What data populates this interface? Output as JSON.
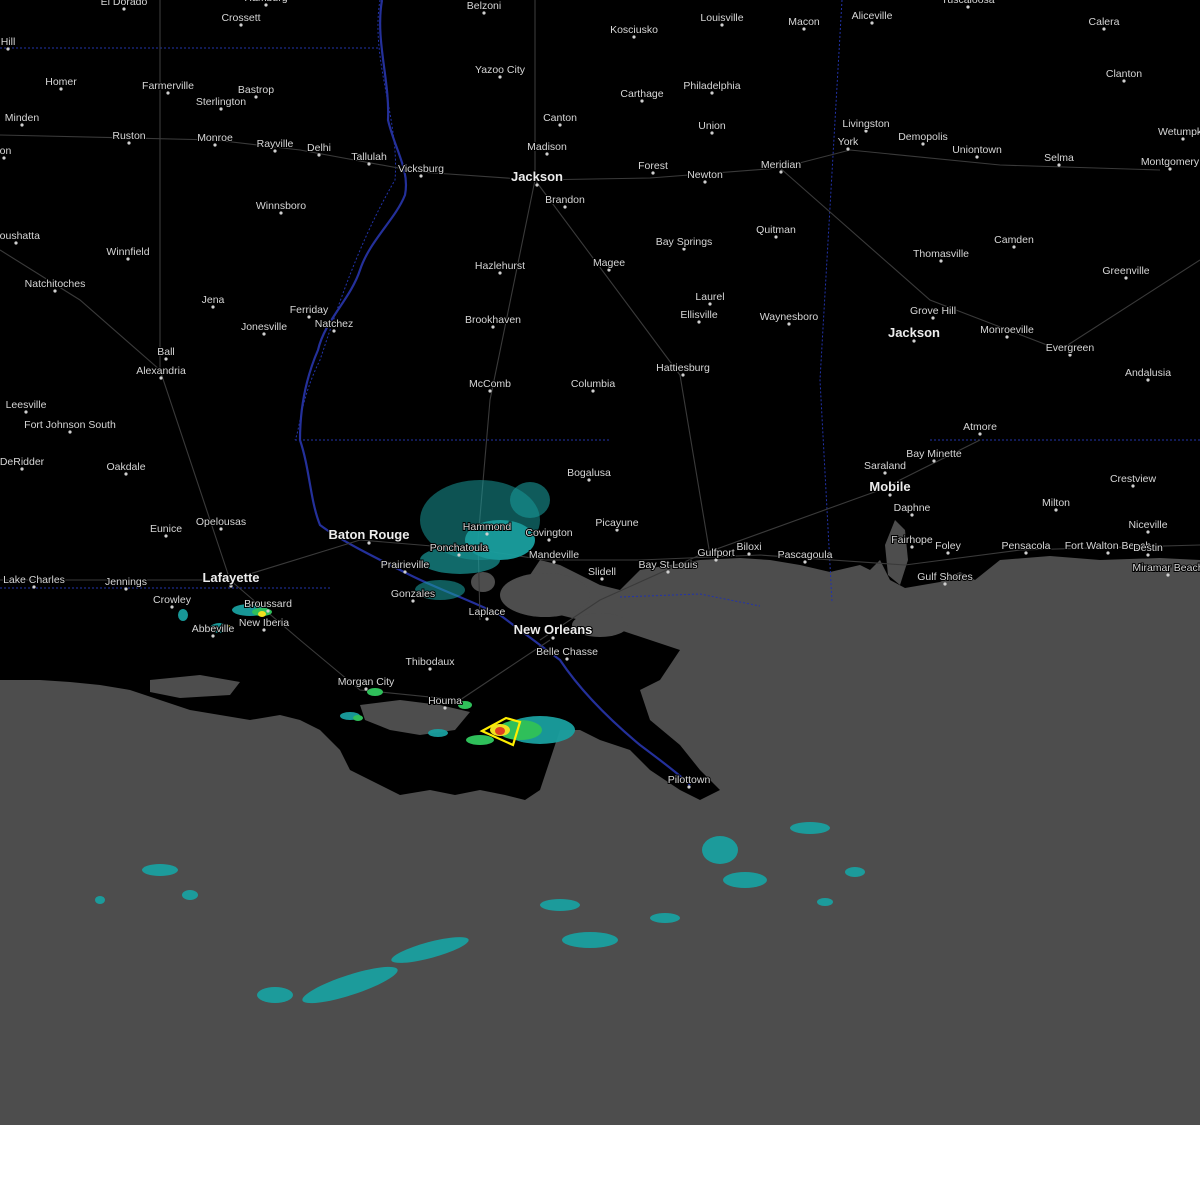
{
  "map": {
    "background_land": "#000000",
    "background_water": "#4d4d4d",
    "bottom_strip": "#ffffff",
    "radar_colors": {
      "light": "#1aa0a0",
      "moderate": "#2fbf5a",
      "heavy": "#f0e020",
      "intense": "#e04020"
    },
    "warning_polygon_color": "#ffee00",
    "state_border_color": "#2233aa"
  },
  "cities": [
    {
      "name": "El Dorado"
    },
    {
      "name": "Hamburg"
    },
    {
      "name": "Belzoni"
    },
    {
      "name": "Kosciusko"
    },
    {
      "name": "Louisville"
    },
    {
      "name": "Macon"
    },
    {
      "name": "Aliceville"
    },
    {
      "name": "Tuscaloosa"
    },
    {
      "name": "Calera"
    },
    {
      "name": "Crossett"
    },
    {
      "name": "Yazoo City"
    },
    {
      "name": "Clanton"
    },
    {
      "name": "Homer"
    },
    {
      "name": "Farmerville"
    },
    {
      "name": "Bastrop"
    },
    {
      "name": "Sterlington"
    },
    {
      "name": "Carthage"
    },
    {
      "name": "Philadelphia"
    },
    {
      "name": "Minden"
    },
    {
      "name": "Canton"
    },
    {
      "name": "Union"
    },
    {
      "name": "Livingston"
    },
    {
      "name": "Wetumpka"
    },
    {
      "name": "Ruston"
    },
    {
      "name": "Monroe"
    },
    {
      "name": "Rayville"
    },
    {
      "name": "Delhi"
    },
    {
      "name": "Madison"
    },
    {
      "name": "York"
    },
    {
      "name": "Demopolis"
    },
    {
      "name": "Uniontown"
    },
    {
      "name": "Selma"
    },
    {
      "name": "Montgomery"
    },
    {
      "name": "Tallulah"
    },
    {
      "name": "Vicksburg"
    },
    {
      "name": "Jackson"
    },
    {
      "name": "Forest"
    },
    {
      "name": "Newton"
    },
    {
      "name": "Meridian"
    },
    {
      "name": "Brandon"
    },
    {
      "name": "Winnsboro"
    },
    {
      "name": "Quitman"
    },
    {
      "name": "Camden"
    },
    {
      "name": "Coushatta"
    },
    {
      "name": "Bay Springs"
    },
    {
      "name": "Winnfield"
    },
    {
      "name": "Thomasville"
    },
    {
      "name": "Hazlehurst"
    },
    {
      "name": "Magee"
    },
    {
      "name": "Greenville"
    },
    {
      "name": "Natchitoches"
    },
    {
      "name": "Laurel"
    },
    {
      "name": "Jena"
    },
    {
      "name": "Ferriday"
    },
    {
      "name": "Grove Hill"
    },
    {
      "name": "Ellisville"
    },
    {
      "name": "Waynesboro"
    },
    {
      "name": "Jonesville"
    },
    {
      "name": "Natchez"
    },
    {
      "name": "Brookhaven"
    },
    {
      "name": "Monroeville"
    },
    {
      "name": "Jackson"
    },
    {
      "name": "Evergreen"
    },
    {
      "name": "Ball"
    },
    {
      "name": "Alexandria"
    },
    {
      "name": "Hattiesburg"
    },
    {
      "name": "Andalusia"
    },
    {
      "name": "McComb"
    },
    {
      "name": "Columbia"
    },
    {
      "name": "Leesville"
    },
    {
      "name": "Fort Johnson South"
    },
    {
      "name": "Atmore"
    },
    {
      "name": "Bay Minette"
    },
    {
      "name": "DeRidder"
    },
    {
      "name": "Oakdale"
    },
    {
      "name": "Saraland"
    },
    {
      "name": "Bogalusa"
    },
    {
      "name": "Crestview"
    },
    {
      "name": "Mobile"
    },
    {
      "name": "Daphne"
    },
    {
      "name": "Milton"
    },
    {
      "name": "Hammond"
    },
    {
      "name": "Opelousas"
    },
    {
      "name": "Picayune"
    },
    {
      "name": "Niceville"
    },
    {
      "name": "Eunice"
    },
    {
      "name": "Covington"
    },
    {
      "name": "Baton Rouge"
    },
    {
      "name": "Fairhope"
    },
    {
      "name": "Foley"
    },
    {
      "name": "Pensacola"
    },
    {
      "name": "Fort Walton Beach"
    },
    {
      "name": "Destin"
    },
    {
      "name": "Ponchatoula"
    },
    {
      "name": "Gulfport"
    },
    {
      "name": "Biloxi"
    },
    {
      "name": "Mandeville"
    },
    {
      "name": "Pascagoula"
    },
    {
      "name": "Prairieville"
    },
    {
      "name": "Bay St Louis"
    },
    {
      "name": "Miramar Beach"
    },
    {
      "name": "Slidell"
    },
    {
      "name": "Gulf Shores"
    },
    {
      "name": "Lake Charles"
    },
    {
      "name": "Jennings"
    },
    {
      "name": "Lafayette"
    },
    {
      "name": "Gonzales"
    },
    {
      "name": "Crowley"
    },
    {
      "name": "Broussard"
    },
    {
      "name": "Laplace"
    },
    {
      "name": "New Iberia"
    },
    {
      "name": "Abbeville"
    },
    {
      "name": "New Orleans"
    },
    {
      "name": "Belle Chasse"
    },
    {
      "name": "Thibodaux"
    },
    {
      "name": "Morgan City"
    },
    {
      "name": "Houma"
    },
    {
      "name": "Pilottown"
    },
    {
      "name": "Hill"
    },
    {
      "name": "ton"
    }
  ]
}
